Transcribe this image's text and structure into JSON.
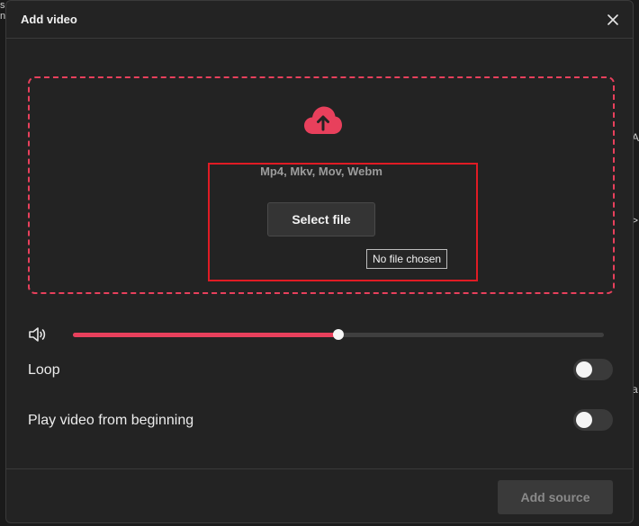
{
  "dialog": {
    "title": "Add video"
  },
  "dropzone": {
    "formats": "Mp4, Mkv, Mov, Webm",
    "select_label": "Select file",
    "file_status": "No file chosen"
  },
  "volume": {
    "level_percent": 50
  },
  "options": [
    {
      "label": "Loop",
      "enabled": false
    },
    {
      "label": "Play video from beginning",
      "enabled": false
    }
  ],
  "footer": {
    "submit_label": "Add source"
  },
  "background_glyphs": {
    "top": "s\nni",
    "right_1": "A",
    "right_2": ">",
    "right_3": "a"
  },
  "colors": {
    "accent": "#e8405c",
    "highlight": "#e01b24",
    "dialog_bg": "#232323"
  },
  "icons": {
    "close": "close-icon",
    "upload": "cloud-upload-icon",
    "volume": "volume-icon"
  }
}
